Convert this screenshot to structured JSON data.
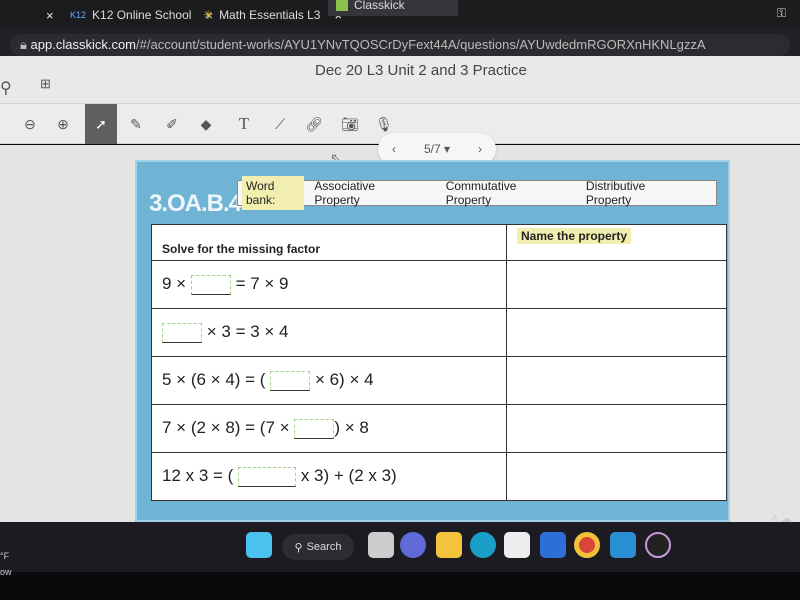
{
  "browser": {
    "tabs": [
      {
        "label": "",
        "close": "×"
      },
      {
        "label": "K12 Online School",
        "icon": "k12-icon",
        "close": "×"
      },
      {
        "label": "Math Essentials L3",
        "icon": "sparkle-icon",
        "close": "×"
      },
      {
        "label": "Classkick",
        "icon": "classkick-icon",
        "active": true
      }
    ],
    "url_host": "app.classkick.com",
    "url_path": "/#/account/student-works/AYU1YNvTQOSCrDyFext44A/questions/AYUwdedmRGORXnHKNLgzzA"
  },
  "app": {
    "title": "Dec 20 L3 Unit 2 and 3 Practice",
    "pager": {
      "prev": "‹",
      "current": "5/7",
      "next": "›"
    }
  },
  "worksheet": {
    "code": "3.OA.B.4",
    "word_bank_label": "Word bank:",
    "word_bank": [
      "Associative Property",
      "Commutative Property",
      "Distributive Property"
    ],
    "col_solve": "Solve for the missing factor",
    "col_property": "Name the property",
    "rows": [
      {
        "before": "9 ×",
        "after": "= 7 × 9"
      },
      {
        "before": "",
        "after": "× 3 = 3 × 4"
      },
      {
        "before": "5 × (6 × 4) = (",
        "after": "× 6) × 4"
      },
      {
        "before": "7 × (2 × 8) = (7 ×",
        "after": ") × 8"
      },
      {
        "before": "12 x 3 =  (",
        "after": "x 3) + (2 x 3)"
      }
    ]
  },
  "taskbar": {
    "search_label": "Search",
    "weather_temp": "°F",
    "weather_text": "ow"
  },
  "colors": {
    "sheet_blue": "#6fb4d4",
    "highlight": "#f1eeb0",
    "selected_tool": "#5f5f5f"
  }
}
